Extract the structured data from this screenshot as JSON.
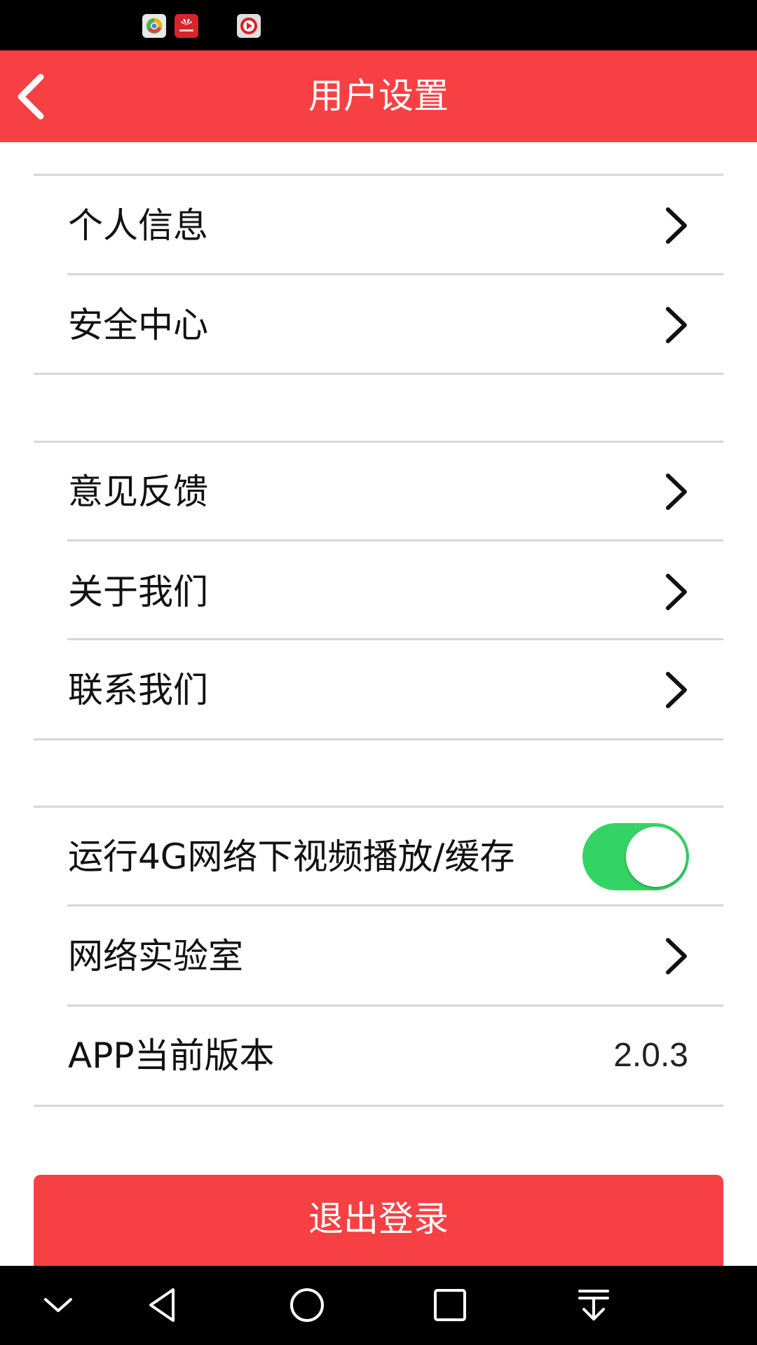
{
  "status_bar": {
    "icons": [
      "browser-app-icon",
      "huawei-app-icon",
      "video-app-icon"
    ]
  },
  "header": {
    "title": "用户设置",
    "back_icon": "chevron-left-icon",
    "background_color": "#f64043"
  },
  "sections": {
    "account": [
      {
        "label": "个人信息",
        "icon": "chevron-right-icon"
      },
      {
        "label": "安全中心",
        "icon": "chevron-right-icon"
      }
    ],
    "about": [
      {
        "label": "意见反馈",
        "icon": "chevron-right-icon"
      },
      {
        "label": "关于我们",
        "icon": "chevron-right-icon"
      },
      {
        "label": "联系我们",
        "icon": "chevron-right-icon"
      }
    ],
    "network": {
      "toggle_label": "运行4G网络下视频播放/缓存",
      "toggle_on": true,
      "toggle_color": "#34d464",
      "lab_label": "网络实验室",
      "version_label": "APP当前版本",
      "version_value": "2.0.3"
    }
  },
  "logout": {
    "label": "退出登录",
    "background_color": "#f64043"
  },
  "nav_bar": {
    "buttons": [
      "hide-nav-icon",
      "back-triangle-icon",
      "home-circle-icon",
      "recents-square-icon",
      "notification-pull-icon"
    ]
  }
}
